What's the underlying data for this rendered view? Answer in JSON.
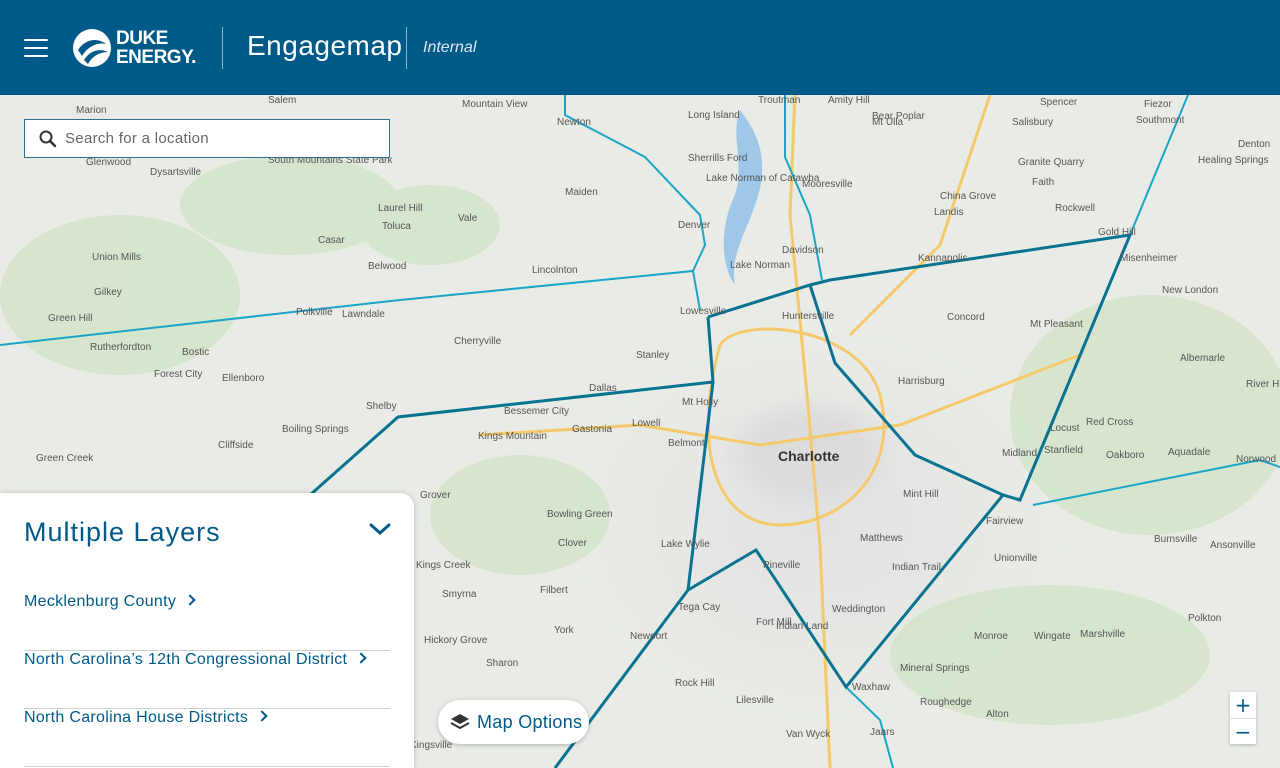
{
  "header": {
    "brand_line1": "DUKE",
    "brand_line2": "ENERGY.",
    "app_title": "Engagemap",
    "app_subtitle": "Internal"
  },
  "search": {
    "placeholder": "Search for a location"
  },
  "panel": {
    "title": "Multiple Layers",
    "layers": [
      {
        "label": "Mecklenburg County"
      },
      {
        "label": "North Carolina’s 12th Congressional District"
      },
      {
        "label": "North Carolina House Districts"
      }
    ]
  },
  "map_options": {
    "label": "Map Options"
  },
  "zoom": {
    "in": "+",
    "out": "−"
  },
  "map": {
    "labels": [
      {
        "text": "Salem"
      },
      {
        "text": "Marion"
      },
      {
        "text": "Mountain View"
      },
      {
        "text": "Newton"
      },
      {
        "text": "Long Island"
      },
      {
        "text": "Troutman"
      },
      {
        "text": "Amity Hill"
      },
      {
        "text": "Spencer"
      },
      {
        "text": "Salisbury"
      },
      {
        "text": "Fiezor"
      },
      {
        "text": "Southmont"
      },
      {
        "text": "Glenwood"
      },
      {
        "text": "Dysartsville"
      },
      {
        "text": "South Mountains State Park"
      },
      {
        "text": "Sherrills Ford"
      },
      {
        "text": "Lake Norman of Catawba"
      },
      {
        "text": "Mooresville"
      },
      {
        "text": "Mt Ulla"
      },
      {
        "text": "Bear Poplar"
      },
      {
        "text": "Granite Quarry"
      },
      {
        "text": "Faith"
      },
      {
        "text": "Healing Springs"
      },
      {
        "text": "Denton"
      },
      {
        "text": "Maiden"
      },
      {
        "text": "Denver"
      },
      {
        "text": "Laurel Hill"
      },
      {
        "text": "Vale"
      },
      {
        "text": "Toluca"
      },
      {
        "text": "China Grove"
      },
      {
        "text": "Landis"
      },
      {
        "text": "Rockwell"
      },
      {
        "text": "Casar"
      },
      {
        "text": "Belwood"
      },
      {
        "text": "Davidson"
      },
      {
        "text": "Kannapolis"
      },
      {
        "text": "Gold Hill"
      },
      {
        "text": "Misenheimer"
      },
      {
        "text": "Union Mills"
      },
      {
        "text": "Lincolnton"
      },
      {
        "text": "Lake Norman"
      },
      {
        "text": "New London"
      },
      {
        "text": "Gilkey"
      },
      {
        "text": "Polkville"
      },
      {
        "text": "Lawndale"
      },
      {
        "text": "Lowesville"
      },
      {
        "text": "Huntersville"
      },
      {
        "text": "Concord"
      },
      {
        "text": "Mt Pleasant"
      },
      {
        "text": "Green Hill"
      },
      {
        "text": "Rutherfordton"
      },
      {
        "text": "Bostic"
      },
      {
        "text": "Cherryville"
      },
      {
        "text": "Stanley"
      },
      {
        "text": "Albemarle"
      },
      {
        "text": "Forest City"
      },
      {
        "text": "Ellenboro"
      },
      {
        "text": "Harrisburg"
      },
      {
        "text": "Dallas"
      },
      {
        "text": "River Hill"
      },
      {
        "text": "Shelby"
      },
      {
        "text": "Bessemer City"
      },
      {
        "text": "Mt Holly"
      },
      {
        "text": "Red Cross"
      },
      {
        "text": "Cliffside"
      },
      {
        "text": "Boiling Springs"
      },
      {
        "text": "Gastonia"
      },
      {
        "text": "Lowell"
      },
      {
        "text": "Kings Mountain"
      },
      {
        "text": "Belmont"
      },
      {
        "text": "Charlotte"
      },
      {
        "text": "Locust"
      },
      {
        "text": "Midland"
      },
      {
        "text": "Stanfield"
      },
      {
        "text": "Oakboro"
      },
      {
        "text": "Aquadale"
      },
      {
        "text": "Norwood"
      },
      {
        "text": "Green Creek"
      },
      {
        "text": "Grover"
      },
      {
        "text": "Mint Hill"
      },
      {
        "text": "Fairview"
      },
      {
        "text": "Bowling Green"
      },
      {
        "text": "Clover"
      },
      {
        "text": "Lake Wylie"
      },
      {
        "text": "Matthews"
      },
      {
        "text": "Unionville"
      },
      {
        "text": "Burnsville"
      },
      {
        "text": "Ansonville"
      },
      {
        "text": "Kings Creek"
      },
      {
        "text": "Smyrna"
      },
      {
        "text": "Filbert"
      },
      {
        "text": "Pineville"
      },
      {
        "text": "Indian Trail"
      },
      {
        "text": "Tega Cay"
      },
      {
        "text": "Fort Mill"
      },
      {
        "text": "Weddington"
      },
      {
        "text": "Hickory Grove"
      },
      {
        "text": "York"
      },
      {
        "text": "Newport"
      },
      {
        "text": "Indian Land"
      },
      {
        "text": "Monroe"
      },
      {
        "text": "Wingate"
      },
      {
        "text": "Marshville"
      },
      {
        "text": "Polkton"
      },
      {
        "text": "Sharon"
      },
      {
        "text": "Mineral Springs"
      },
      {
        "text": "Rock Hill"
      },
      {
        "text": "Waxhaw"
      },
      {
        "text": "Roughedge"
      },
      {
        "text": "Alton"
      },
      {
        "text": "Lilesville"
      },
      {
        "text": "Van Wyck"
      },
      {
        "text": "Jaars"
      },
      {
        "text": "Kingsville"
      }
    ]
  }
}
